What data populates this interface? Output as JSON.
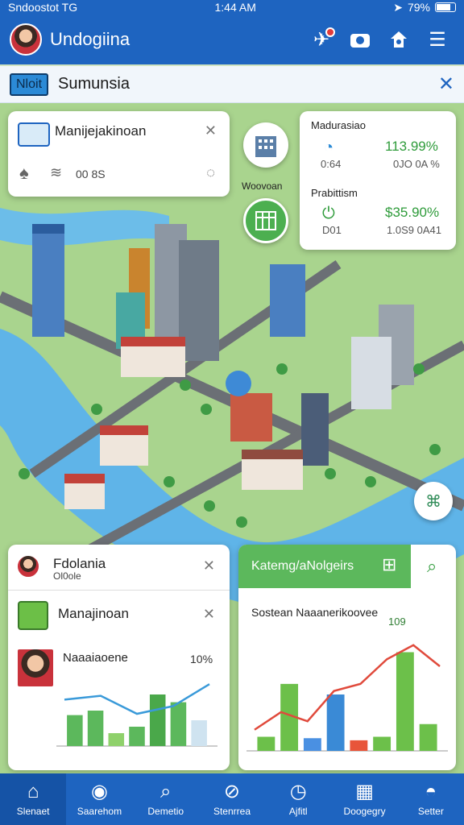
{
  "status": {
    "time_left": "Sndoostot TG",
    "time": "1:44 AM",
    "battery": "79%"
  },
  "header": {
    "title": "Undogiina",
    "icons": [
      "tool-icon",
      "camera-icon",
      "home-icon",
      "menu-icon"
    ]
  },
  "search": {
    "tag": "Nloit",
    "value": "Sumunsia"
  },
  "card_top_left": {
    "title": "Manijejakinoan",
    "meta": "00 8S"
  },
  "map_pins": {
    "building_label": "Woovoan"
  },
  "card_top_right": {
    "row1": {
      "label": "Madurasiao",
      "value": "113.99%",
      "sub_left": "0:64",
      "sub_right": "0JO 0A %"
    },
    "row2": {
      "label": "Prabittism",
      "value": "$35.90%",
      "sub_left": "D01",
      "sub_right": "1.0S9 0A41"
    }
  },
  "card_bottom_left": {
    "title": "Fdolania",
    "subtitle": "Ol0ole",
    "row_label": "Manajinoan",
    "chart_label": "Naaaiaoene",
    "chart_value": "10%"
  },
  "card_bottom_right": {
    "header": "Katemg/aNolgeirs",
    "chart_title": "Sostean Naaanerikoovee",
    "chart_value": "109"
  },
  "bottom_nav": [
    {
      "label": "Slenaet",
      "icon": "home-icon"
    },
    {
      "label": "Saarehom",
      "icon": "globe-icon"
    },
    {
      "label": "Demetio",
      "icon": "search-icon"
    },
    {
      "label": "Stenrrea",
      "icon": "compass-icon"
    },
    {
      "label": "Ajfitl",
      "icon": "gauge-icon"
    },
    {
      "label": "Doogegry",
      "icon": "calendar-icon"
    },
    {
      "label": "Setter",
      "icon": "user-icon"
    }
  ],
  "colors": {
    "brand": "#1e64c0",
    "accent_green": "#4caf50",
    "water": "#5fb4e8"
  },
  "chart_data": [
    {
      "type": "bar",
      "title": "Naaaiaoene",
      "values": [
        48,
        55,
        20,
        30,
        80,
        68,
        40
      ],
      "line_values": [
        72,
        78,
        50,
        62,
        96
      ],
      "annotation": "10%"
    },
    {
      "type": "bar",
      "title": "Sostean Naaanerikoovee",
      "values": [
        20,
        95,
        18,
        80,
        15,
        20,
        140,
        38
      ],
      "line_values": [
        30,
        55,
        42,
        85,
        95,
        130,
        150,
        120
      ],
      "annotation": "109"
    }
  ]
}
